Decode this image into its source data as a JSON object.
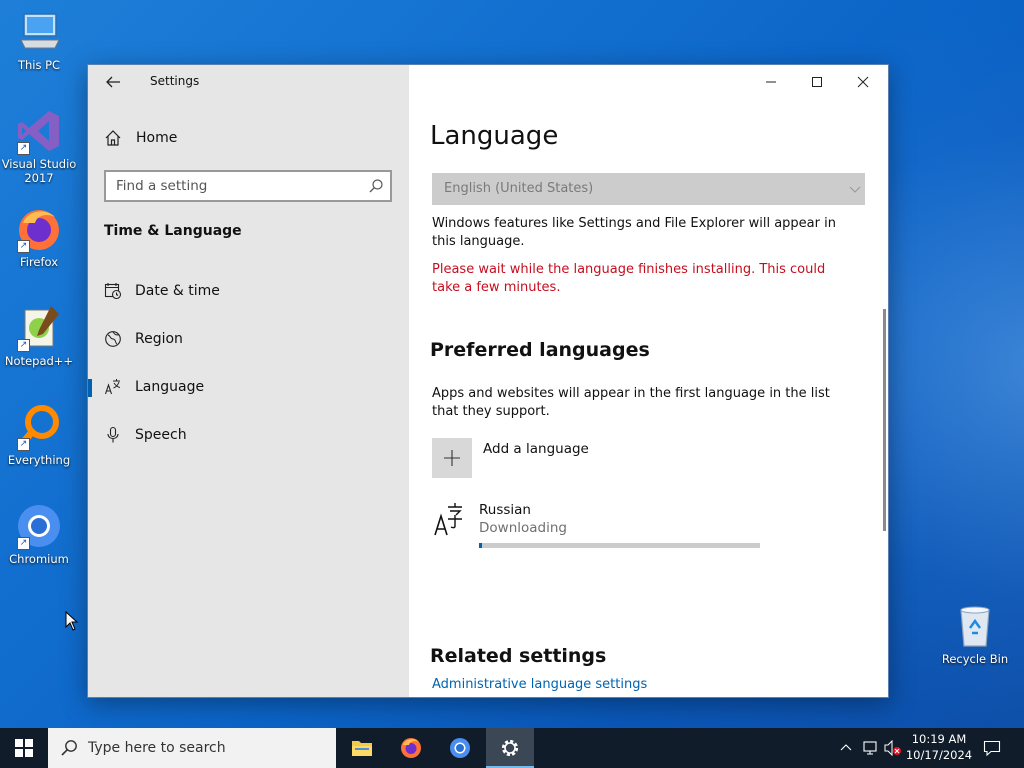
{
  "desktop": {
    "icons": [
      {
        "label": "This PC",
        "icon": "computer-icon"
      },
      {
        "label": "Visual Studio 2017",
        "icon": "visual-studio-icon"
      },
      {
        "label": "Firefox",
        "icon": "firefox-icon"
      },
      {
        "label": "Notepad++",
        "icon": "notepad-plus-plus-icon"
      },
      {
        "label": "Everything",
        "icon": "everything-search-icon"
      },
      {
        "label": "Chromium",
        "icon": "chromium-icon"
      }
    ],
    "recycle_bin": {
      "label": "Recycle Bin",
      "icon": "recycle-bin-icon"
    }
  },
  "window": {
    "title": "Settings",
    "sidebar": {
      "home_label": "Home",
      "search_placeholder": "Find a setting",
      "section_heading": "Time & Language",
      "items": [
        {
          "label": "Date & time",
          "icon": "calendar-clock-icon",
          "active": false
        },
        {
          "label": "Region",
          "icon": "globe-icon",
          "active": false
        },
        {
          "label": "Language",
          "icon": "language-icon",
          "active": true
        },
        {
          "label": "Speech",
          "icon": "microphone-icon",
          "active": false
        }
      ]
    },
    "content": {
      "page_title": "Language",
      "display_language": "English (United States)",
      "display_language_desc": "Windows features like Settings and File Explorer will appear in this language.",
      "install_warning": "Please wait while the language finishes installing. This could take a few minutes.",
      "preferred_heading": "Preferred languages",
      "preferred_desc": "Apps and websites will appear in the first language in the list that they support.",
      "add_language_label": "Add a language",
      "languages": [
        {
          "name": "Russian",
          "status": "Downloading",
          "progress": 0.01
        }
      ],
      "related_heading": "Related settings",
      "related_link": "Administrative language settings"
    }
  },
  "taskbar": {
    "search_placeholder": "Type here to search",
    "apps": [
      {
        "name": "File Explorer",
        "icon": "folder-icon",
        "active": false
      },
      {
        "name": "Firefox",
        "icon": "firefox-icon",
        "active": false
      },
      {
        "name": "Chromium",
        "icon": "chromium-icon",
        "active": false
      },
      {
        "name": "Settings",
        "icon": "gear-icon",
        "active": true
      }
    ],
    "time": "10:19 AM",
    "date": "10/17/2024"
  },
  "colors": {
    "accent": "#0063b1",
    "warning": "#c50f1f",
    "sidebar_bg": "#e6e6e6",
    "taskbar_bg": "#101c2a"
  }
}
